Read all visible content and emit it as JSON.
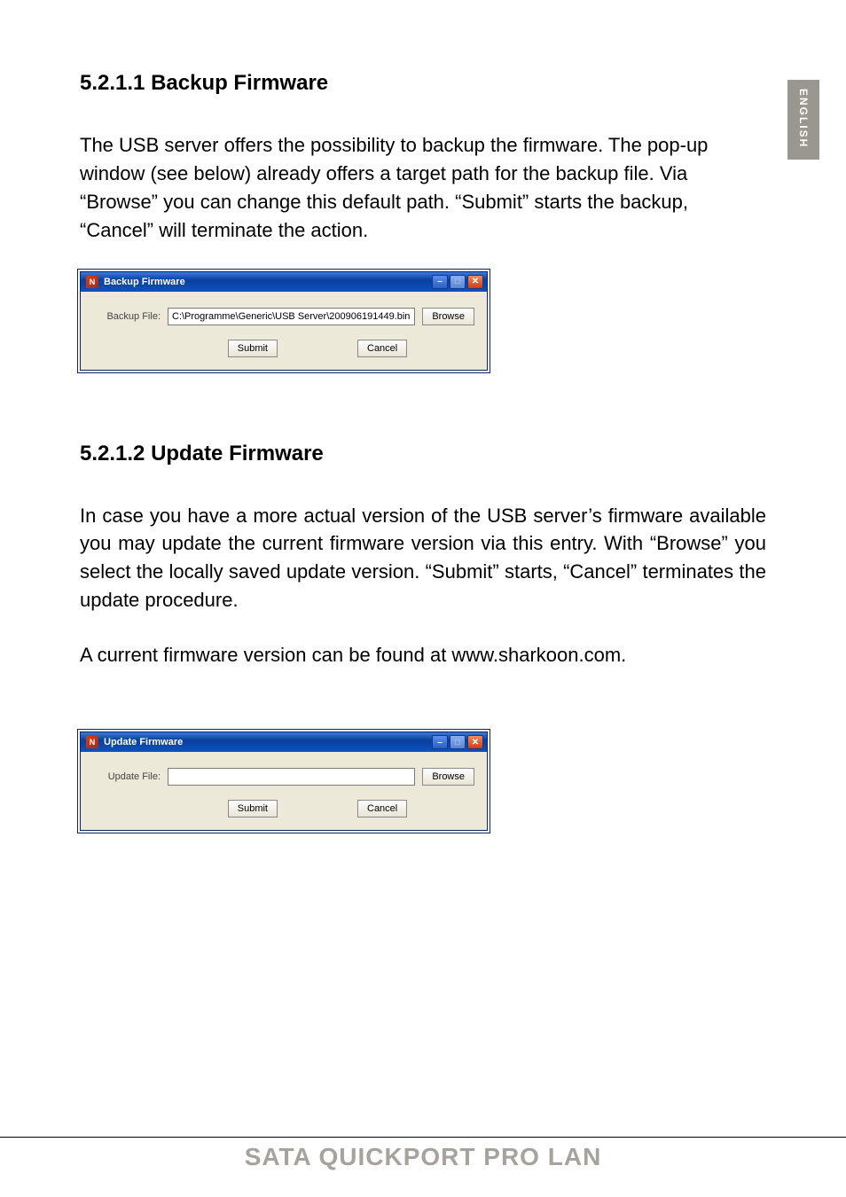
{
  "side_tab": {
    "label": "ENGLISH"
  },
  "section1": {
    "heading": "5.2.1.1 Backup Firmware",
    "para": "The USB server offers the possibility to backup the firmware. The pop-up window (see below) already offers a target path for the backup file. Via “Browse” you can change this default path. “Submit” starts the backup, “Cancel” will terminate the action."
  },
  "dialog1": {
    "title": "Backup Firmware",
    "label": "Backup File:",
    "value": "C:\\Programme\\Generic\\USB Server\\200906191449.bin",
    "browse": "Browse",
    "submit": "Submit",
    "cancel": "Cancel",
    "win_icon_glyph": "N"
  },
  "section2": {
    "heading": "5.2.1.2 Update Firmware",
    "para1": "In case you have a more actual version of the USB server’s firmware available you may update the current firmware version via this entry. With “Browse” you select the locally saved update version. “Submit” starts, “Cancel” terminates the update procedure.",
    "para2": "A current firmware version can be found at www.sharkoon.com."
  },
  "dialog2": {
    "title": "Update Firmware",
    "label": "Update File:",
    "value": "",
    "browse": "Browse",
    "submit": "Submit",
    "cancel": "Cancel",
    "win_icon_glyph": "N"
  },
  "footer": {
    "title": "SATA QUICKPORT PRO LAN"
  },
  "win_ctrls": {
    "min": "–",
    "max": "□",
    "close": "✕"
  }
}
